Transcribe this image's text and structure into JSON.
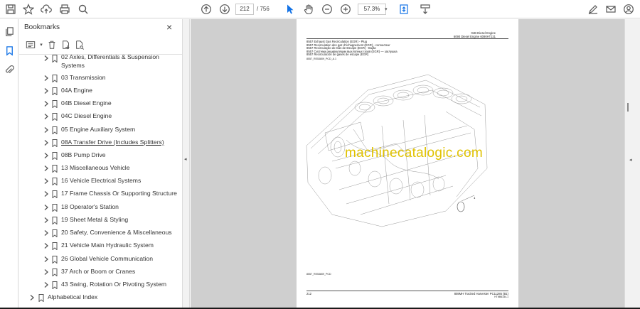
{
  "toolbar": {
    "page_current": "212",
    "page_total": "/ 756",
    "zoom": "57.3%"
  },
  "panel": {
    "title": "Bookmarks",
    "close": "×"
  },
  "bookmarks": [
    {
      "label": "02 Axles, Differentials & Suspension",
      "label2": "Systems",
      "level": 1
    },
    {
      "label": "03 Transmission",
      "level": 1
    },
    {
      "label": "04A Engine",
      "level": 1
    },
    {
      "label": "04B Diesel Engine",
      "level": 1
    },
    {
      "label": "04C Diesel Engine",
      "level": 1
    },
    {
      "label": "05 Engine Auxiliary System",
      "level": 1
    },
    {
      "label": "08A Transfer Drive (Includes Splitters)",
      "level": 1,
      "underline": true
    },
    {
      "label": "08B Pump Drive",
      "level": 1
    },
    {
      "label": "13 Miscellaneous Vehicle",
      "level": 1
    },
    {
      "label": "16 Vehicle Electrical Systems",
      "level": 1
    },
    {
      "label": "17 Frame Chassis Or Supporting Structure",
      "level": 1
    },
    {
      "label": "18 Operator's Station",
      "level": 1
    },
    {
      "label": "19 Sheet Metal & Styling",
      "level": 1
    },
    {
      "label": "20 Safety, Convenience & Miscellaneous",
      "level": 1
    },
    {
      "label": "21 Vehicle Main Hydraulic System",
      "level": 1
    },
    {
      "label": "26 Global Vehicle Communication",
      "level": 1
    },
    {
      "label": "37 Arch or Boom or Cranes",
      "level": 1
    },
    {
      "label": "43 Swing, Rotation Or Pivoting System",
      "level": 1
    },
    {
      "label": "Alphabetical Index",
      "level": 0
    }
  ],
  "document": {
    "header_right_1": "04B Diesel Engine",
    "header_right_2": "6090 Diesel Engine 6090HTJ21",
    "title_lines": [
      "8557 Exhaust Gas Recirculation (EGR) - Plug",
      "8557 Recirculation des gaz d'échappement (EGR) - connecteur",
      "8557 Recirculação do Gás de Escape (EGR) - Bujão",
      "8557 Система рециркуляции выхлопных газов (EGR) — заглушка",
      "8557 Recirculación de gases de escape (EGR)"
    ],
    "ref_code": "8557_RE53809_PCD_A.1",
    "callout": "1",
    "fig_code": "8557_RE53809_PCD",
    "footer_left": "212",
    "footer_right": "859MH Tracked Harvester  PC11285  (B1)",
    "footer_right_2": "HTM56334-1",
    "watermark": "machinecatalogic.com"
  },
  "colors": {
    "watermark": "#e0c200",
    "viewer_bg": "#cfcfcf",
    "accent": "#1473e6"
  }
}
